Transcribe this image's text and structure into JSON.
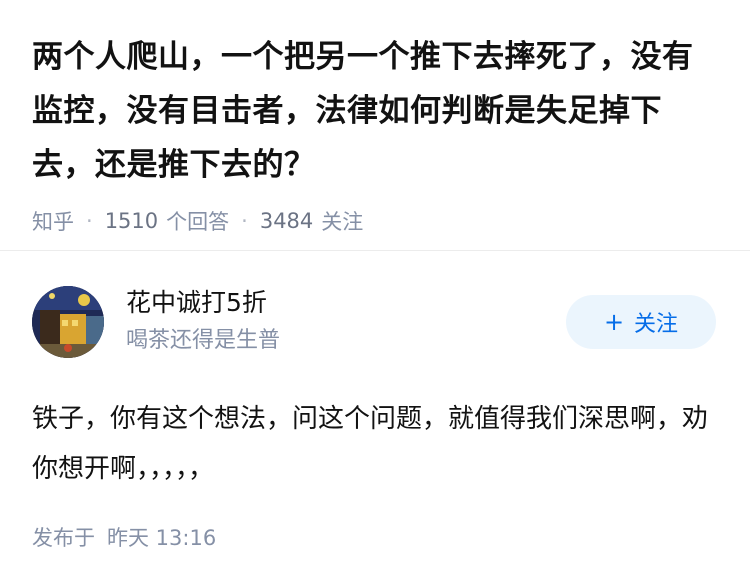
{
  "question": {
    "title": "两个人爬山，一个把另一个推下去摔死了，没有监控，没有目击者，法律如何判断是失足掉下去，还是推下去的？",
    "source": "知乎",
    "separator": "·",
    "answer_count": "1510",
    "answer_label": "个回答",
    "follower_count": "3484",
    "follower_label": "关注"
  },
  "answer": {
    "author": {
      "name": "花中诚打5折",
      "bio": "喝茶还得是生普",
      "avatar_icon": "avatar-painting"
    },
    "follow_button": {
      "icon": "+",
      "label": "关注"
    },
    "content": "铁子，你有这个想法，问这个问题，就值得我们深思啊，劝你想开啊，，，，，",
    "published_label": "发布于",
    "published_time": "昨天 13:16"
  },
  "colors": {
    "primary_text": "#121212",
    "secondary_text": "#8590a6",
    "accent_blue": "#056de8",
    "button_bg": "#ebf5fd",
    "divider": "#ececec"
  }
}
